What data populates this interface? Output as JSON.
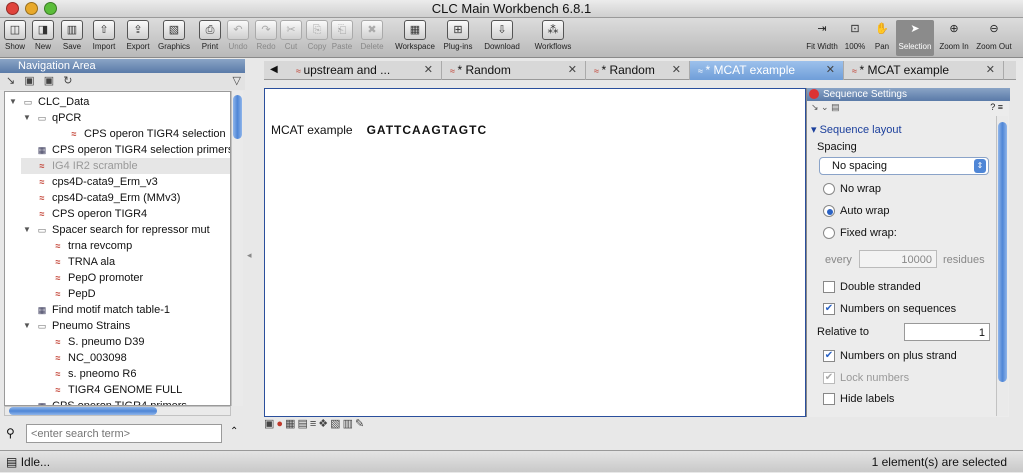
{
  "window": {
    "title": "CLC Main Workbench 6.8.1"
  },
  "toolbar": {
    "items": [
      {
        "label": "Show",
        "icon": "show-icon"
      },
      {
        "label": "New",
        "icon": "new-icon"
      },
      {
        "label": "Save",
        "icon": "save-icon"
      },
      {
        "label": "Import",
        "icon": "import-icon"
      },
      {
        "label": "Export",
        "icon": "export-icon"
      },
      {
        "label": "Graphics",
        "icon": "graphics-icon"
      },
      {
        "label": "Print",
        "icon": "print-icon"
      },
      {
        "label": "Undo",
        "icon": "undo-icon"
      },
      {
        "label": "Redo",
        "icon": "redo-icon"
      },
      {
        "label": "Cut",
        "icon": "cut-icon"
      },
      {
        "label": "Copy",
        "icon": "copy-icon"
      },
      {
        "label": "Paste",
        "icon": "paste-icon"
      },
      {
        "label": "Delete",
        "icon": "delete-icon"
      },
      {
        "label": "Workspace",
        "icon": "workspace-icon"
      },
      {
        "label": "Plug-ins",
        "icon": "plugins-icon"
      },
      {
        "label": "Download",
        "icon": "download-icon"
      },
      {
        "label": "Workflows",
        "icon": "workflows-icon"
      }
    ],
    "right": [
      {
        "label": "Fit Width"
      },
      {
        "label": "100%"
      },
      {
        "label": "Pan"
      },
      {
        "label": "Selection"
      },
      {
        "label": "Zoom In"
      },
      {
        "label": "Zoom Out"
      }
    ]
  },
  "nav": {
    "title": "Navigation Area",
    "search_placeholder": "<enter search term>",
    "tree": [
      {
        "label": "CLC_Data",
        "type": "folder",
        "expanded": true
      },
      {
        "label": "qPCR",
        "type": "folder",
        "expanded": true
      },
      {
        "label": "CPS operon TIGR4 selection",
        "type": "seq"
      },
      {
        "label": "CPS operon TIGR4 selection primers",
        "type": "table"
      },
      {
        "label": "IG4 IR2 scramble",
        "type": "seq"
      },
      {
        "label": "cps4D-cata9_Erm_v3",
        "type": "seq"
      },
      {
        "label": "cps4D-cata9_Erm (MMv3)",
        "type": "seq"
      },
      {
        "label": "CPS operon TIGR4",
        "type": "seq"
      },
      {
        "label": "Spacer search for repressor mut",
        "type": "folder",
        "expanded": true
      },
      {
        "label": "trna revcomp",
        "type": "seq"
      },
      {
        "label": "TRNA ala",
        "type": "seq"
      },
      {
        "label": "PepO promoter",
        "type": "seq"
      },
      {
        "label": "PepD",
        "type": "seq"
      },
      {
        "label": "Find motif match table-1",
        "type": "table"
      },
      {
        "label": "Pneumo Strains",
        "type": "folder",
        "expanded": true
      },
      {
        "label": "S. pneumo D39",
        "type": "seq"
      },
      {
        "label": "NC_003098",
        "type": "seq"
      },
      {
        "label": "s. pneomo R6",
        "type": "seq"
      },
      {
        "label": "TIGR4 GENOME FULL",
        "type": "seq"
      },
      {
        "label": "CPS operon TIGR4 primers",
        "type": "table"
      }
    ]
  },
  "tabs": [
    {
      "label": "upstream and ..."
    },
    {
      "label": "* Random"
    },
    {
      "label": "* Random"
    },
    {
      "label": "* MCAT example"
    },
    {
      "label": "* MCAT example"
    }
  ],
  "viewer": {
    "name": "MCAT example",
    "sequence": "GATTCAAGTAGTC"
  },
  "settings": {
    "title": "Sequence Settings",
    "section": "Sequence layout",
    "spacing_label": "Spacing",
    "spacing_value": "No spacing",
    "no_wrap": "No wrap",
    "auto_wrap": "Auto wrap",
    "fixed_wrap": "Fixed wrap:",
    "every": "every",
    "every_value": "10000",
    "residues": "residues",
    "double_stranded": "Double stranded",
    "numbers_on_sequences": "Numbers on sequences",
    "relative_to": "Relative to",
    "relative_value": "1",
    "numbers_plus": "Numbers on plus strand",
    "lock_numbers": "Lock numbers",
    "hide_labels": "Hide labels"
  },
  "status": {
    "left": "Idle...",
    "right": "1 element(s) are selected"
  }
}
